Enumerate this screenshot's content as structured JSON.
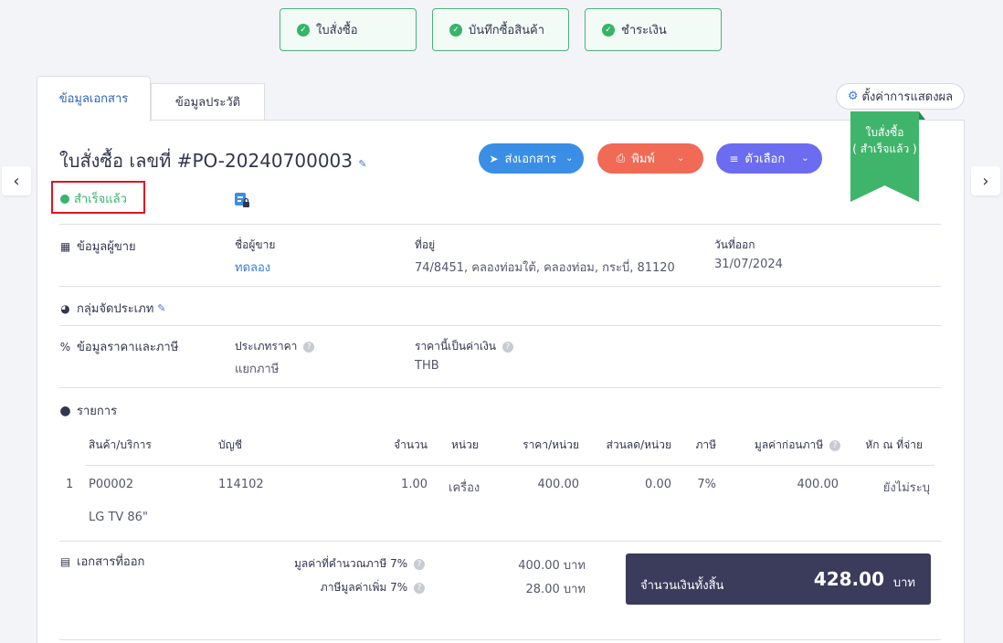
{
  "steps": [
    {
      "label": "ใบสั่งซื้อ"
    },
    {
      "label": "บันทึกซื้อสินค้า"
    },
    {
      "label": "ชำระเงิน"
    }
  ],
  "tabs": {
    "active": "ข้อมูลเอกสาร",
    "inactive": "ข้อมูลประวัติ"
  },
  "settings_label": "ตั้งค่าการแสดงผล",
  "ribbon": {
    "line1": "ใบสั่งซื้อ",
    "line2": "( สำเร็จแล้ว )"
  },
  "doc": {
    "title": "ใบสั่งซื้อ เลขที่ #PO-20240700003",
    "status": "สำเร็จแล้ว"
  },
  "actions": {
    "send": "ส่งเอกสาร",
    "print": "พิมพ์",
    "options": "ตัวเลือก"
  },
  "colors": {
    "send": "#3a8ee6",
    "print": "#f06a55",
    "options": "#6c6cf0",
    "success": "#35b46a",
    "total_bg": "#3b3b5c"
  },
  "vendor": {
    "section": "ข้อมูลผู้ขาย",
    "name_label": "ชื่อผู้ขาย",
    "name": "ทดลอง",
    "address_label": "ที่อยู่",
    "address": "74/8451, คลองท่อมใต้, คลองท่อม, กระบี่, 81120",
    "date_label": "วันที่ออก",
    "date": "31/07/2024"
  },
  "category": {
    "section": "กลุ่มจัดประเภท"
  },
  "pricing": {
    "section": "ข้อมูลราคาและภาษี",
    "type_label": "ประเภทราคา",
    "type": "แยกภาษี",
    "currency_label": "ราคานี้เป็นค่าเงิน",
    "currency": "THB"
  },
  "items": {
    "section": "รายการ",
    "headers": {
      "product": "สินค้า/บริการ",
      "account": "บัญชี",
      "qty": "จำนวน",
      "unit": "หน่วย",
      "price": "ราคา/หน่วย",
      "discount": "ส่วนลด/หน่วย",
      "tax": "ภาษี",
      "pretax": "มูลค่าก่อนภาษี",
      "wht": "หัก ณ ที่จ่าย"
    },
    "rows": [
      {
        "no": "1",
        "code": "P00002",
        "account": "114102",
        "qty": "1.00",
        "unit": "เครื่อง",
        "price": "400.00",
        "discount": "0.00",
        "tax": "7%",
        "pretax": "400.00",
        "wht": "ยังไม่ระบุ",
        "desc": "LG TV 86\""
      }
    ]
  },
  "issued": {
    "section": "เอกสารที่ออก"
  },
  "summary": {
    "taxable_label": "มูลค่าที่คำนวณภาษี 7%",
    "taxable": "400.00 บาท",
    "vat_label": "ภาษีมูลค่าเพิ่ม 7%",
    "vat": "28.00 บาท",
    "total_label": "จำนวนเงินทั้งสิ้น",
    "total": "428.00",
    "total_unit": "บาท"
  }
}
